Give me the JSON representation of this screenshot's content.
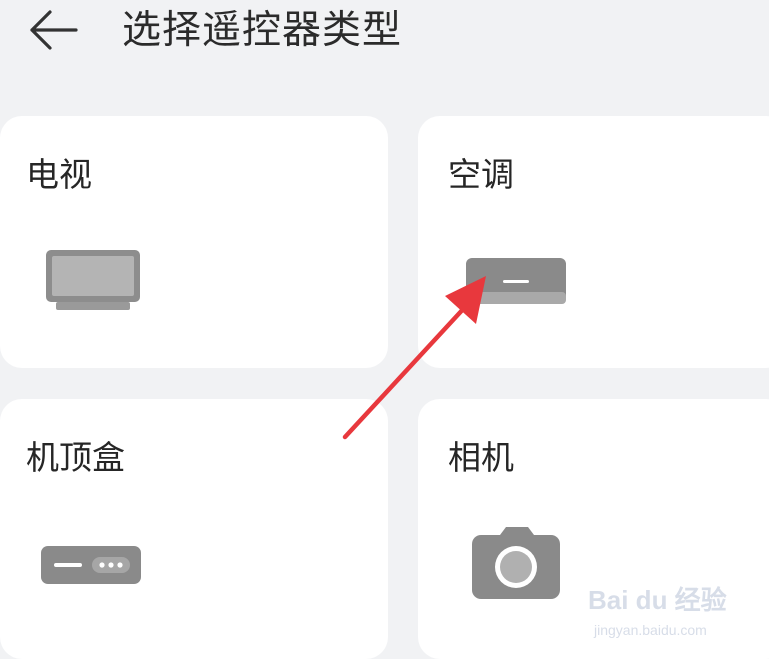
{
  "header": {
    "title": "选择遥控器类型"
  },
  "cards": [
    {
      "label": "电视",
      "icon": "tv-icon"
    },
    {
      "label": "空调",
      "icon": "air-conditioner-icon"
    },
    {
      "label": "机顶盒",
      "icon": "set-top-box-icon"
    },
    {
      "label": "相机",
      "icon": "camera-icon"
    }
  ],
  "colors": {
    "background": "#f1f2f4",
    "card": "#ffffff",
    "icon_gray": "#8a8a8a",
    "annotation_arrow": "#e8383d"
  },
  "watermark": {
    "brand": "Bai du 经验",
    "url": "jingyan.baidu.com"
  }
}
